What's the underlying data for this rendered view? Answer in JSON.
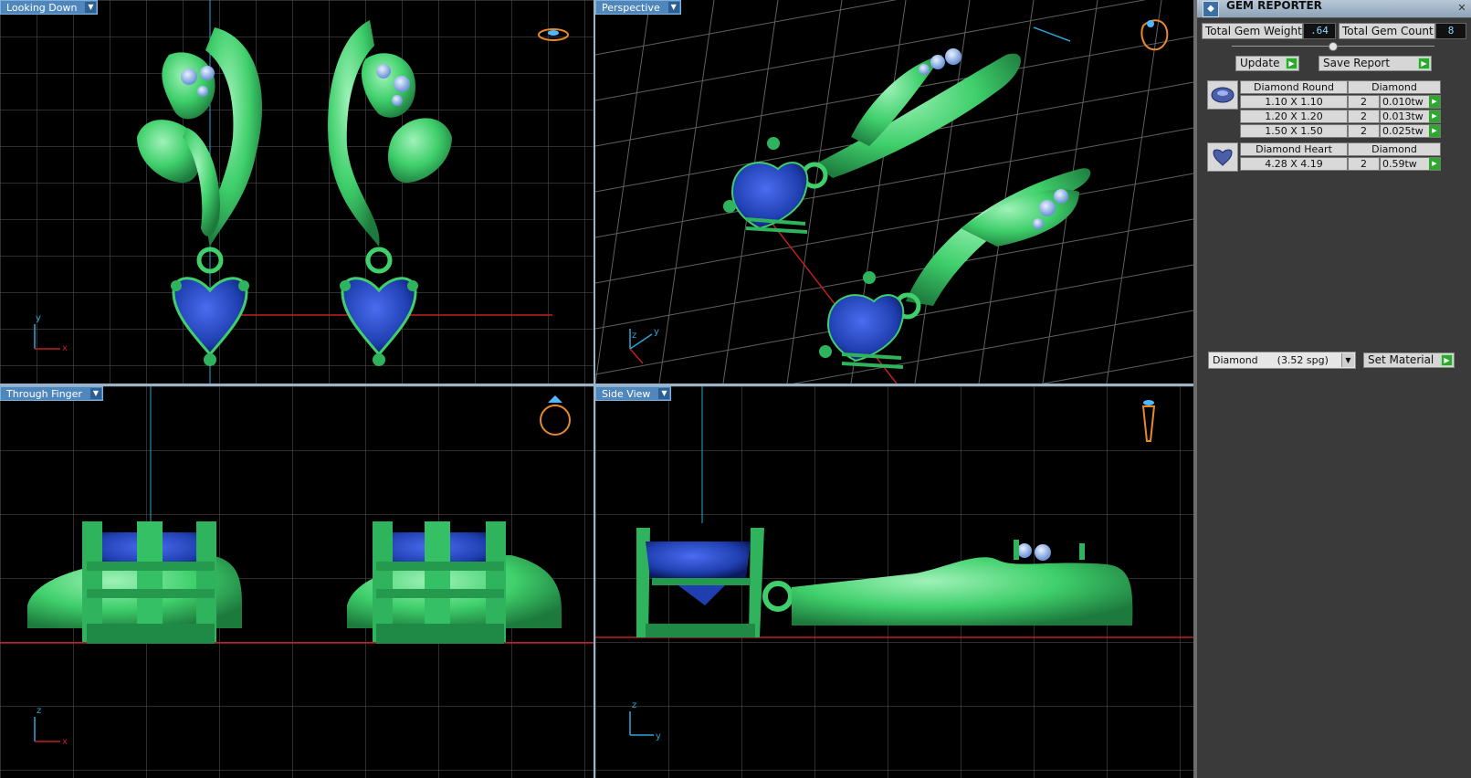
{
  "viewports": {
    "top_left": {
      "label": "Looking Down",
      "axes": [
        "y",
        "x"
      ]
    },
    "top_right": {
      "label": "Perspective",
      "axes": [
        "z",
        "y"
      ]
    },
    "bottom_left": {
      "label": "Through Finger",
      "axes": [
        "z",
        "x"
      ]
    },
    "bottom_right": {
      "label": "Side View",
      "axes": [
        "z",
        "y"
      ]
    }
  },
  "icons": {
    "dropdown": "dropdown-arrow-icon",
    "ring_top": "ring-orientation-icon",
    "go": "play-arrow-icon"
  },
  "colors": {
    "metal": "#3fcf6b",
    "gem": "#1f3fb0",
    "grid": "#6e6e6e",
    "axis_red": "#c0201e",
    "axis_blue": "#2aa6d6",
    "viewport_tab": "#4f87bd"
  },
  "panel": {
    "title": "GEM REPORTER",
    "close": "✕",
    "total_gem_weight_label": "Total Gem Weight",
    "total_gem_weight_value": ".64",
    "total_gem_count_label": "Total Gem Count",
    "total_gem_count_value": "8",
    "update_label": "Update",
    "save_report_label": "Save Report",
    "gem_groups": [
      {
        "name": "Diamond Round",
        "material": "Diamond",
        "rows": [
          {
            "size": "1.10 X 1.10",
            "count": "2",
            "weight": "0.010tw"
          },
          {
            "size": "1.20 X 1.20",
            "count": "2",
            "weight": "0.013tw"
          },
          {
            "size": "1.50 X 1.50",
            "count": "2",
            "weight": "0.025tw"
          }
        ]
      },
      {
        "name": "Diamond Heart",
        "material": "Diamond",
        "rows": [
          {
            "size": "4.28 X 4.19",
            "count": "2",
            "weight": "0.59tw"
          }
        ]
      }
    ],
    "material_select": "Diamond      (3.52 spg)",
    "set_material_label": "Set Material"
  }
}
